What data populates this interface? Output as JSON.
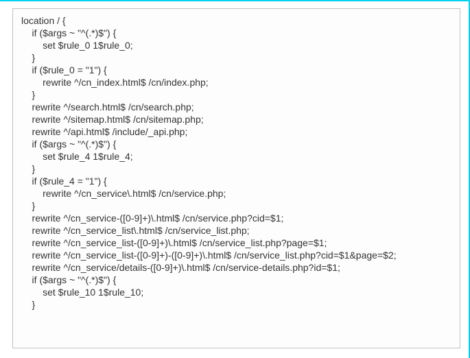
{
  "lines": [
    "location / {",
    "    if ($args ~ \"^(.*)$\") {",
    "        set $rule_0 1$rule_0;",
    "    }",
    "",
    "    if ($rule_0 = \"1\") {",
    "        rewrite ^/cn_index.html$ /cn/index.php;",
    "    }",
    "    rewrite ^/search.html$ /cn/search.php;",
    "    rewrite ^/sitemap.html$ /cn/sitemap.php;",
    "    rewrite ^/api.html$ /include/_api.php;",
    "",
    "    if ($args ~ \"^(.*)$\") {",
    "        set $rule_4 1$rule_4;",
    "    }",
    "",
    "    if ($rule_4 = \"1\") {",
    "        rewrite ^/cn_service\\.html$ /cn/service.php;",
    "    }",
    "    rewrite ^/cn_service-([0-9]+)\\.html$ /cn/service.php?cid=$1;",
    "    rewrite ^/cn_service_list\\.html$ /cn/service_list.php;",
    "    rewrite ^/cn_service_list-([0-9]+)\\.html$ /cn/service_list.php?page=$1;",
    "    rewrite ^/cn_service_list-([0-9]+)-([0-9]+)\\.html$ /cn/service_list.php?cid=$1&page=$2;",
    "    rewrite ^/cn_service/details-([0-9]+)\\.html$ /cn/service-details.php?id=$1;",
    "",
    "    if ($args ~ \"^(.*)$\") {",
    "        set $rule_10 1$rule_10;",
    "    }"
  ]
}
